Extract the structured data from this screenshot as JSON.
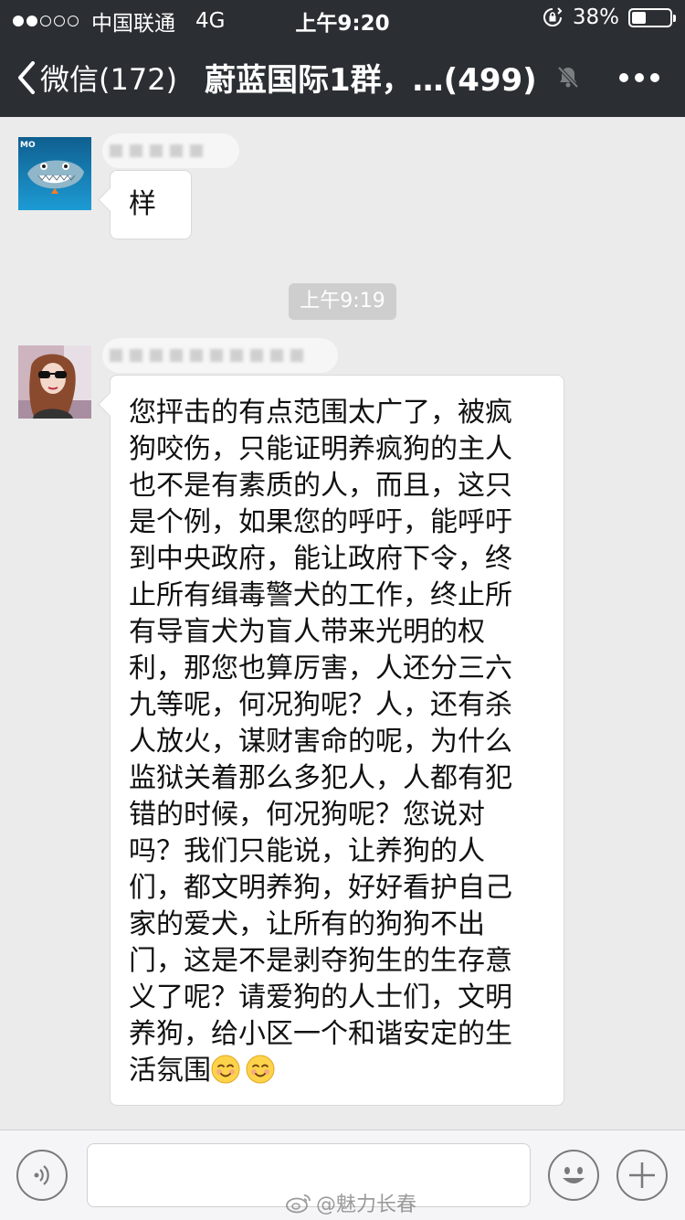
{
  "status_bar": {
    "carrier": "中国联通",
    "network": "4G",
    "time": "上午9:20",
    "battery_text": "38%",
    "battery_level": 0.38,
    "signal_bars_filled": 2,
    "signal_bars_total": 5
  },
  "nav": {
    "back_label": "微信(172)",
    "title": "蔚蓝国际1群，…(499)",
    "mute_icon": "bell-slash-icon",
    "more_icon": "more-icon"
  },
  "messages": [
    {
      "sender": "blurred",
      "text": "样"
    },
    {
      "type": "timestamp",
      "text": "上午9:19"
    },
    {
      "sender": "blurred",
      "lines": [
        "您抨击的有点范围太广了，被疯",
        "狗咬伤，只能证明养疯狗的主人",
        "也不是有素质的人，而且，这只",
        "是个例，如果您的呼吁，能呼吁",
        "到中央政府，能让政府下令，终",
        "止所有缉毒警犬的工作，终止所",
        "有导盲犬为盲人带来光明的权",
        "利，那您也算厉害，人还分三六",
        "九等呢，何况狗呢？人，还有杀",
        "人放火，谋财害命的呢，为什么",
        "监狱关着那么多犯人，人都有犯",
        "错的时候，何况狗呢？您说对",
        "吗？我们只能说，让养狗的人",
        "们，都文明养狗，好好看护自己",
        "家的爱犬，让所有的狗狗不出",
        "门，这是不是剥夺狗生的生存意",
        "义了呢？请爱狗的人士们，文明",
        "养狗，给小区一个和谐安定的生",
        "活氛围"
      ],
      "emoji_icon": "blush-emoji-icon",
      "emoji_count": 2
    }
  ],
  "input_bar": {
    "voice_icon": "voice-icon",
    "emoji_icon": "emoji-icon",
    "plus_icon": "plus-icon",
    "text": ""
  },
  "watermark": "@魅力长春",
  "colors": {
    "nav_bg": "#2b2f33",
    "chat_bg": "#ebebeb",
    "bubble_bg": "#ffffff"
  }
}
